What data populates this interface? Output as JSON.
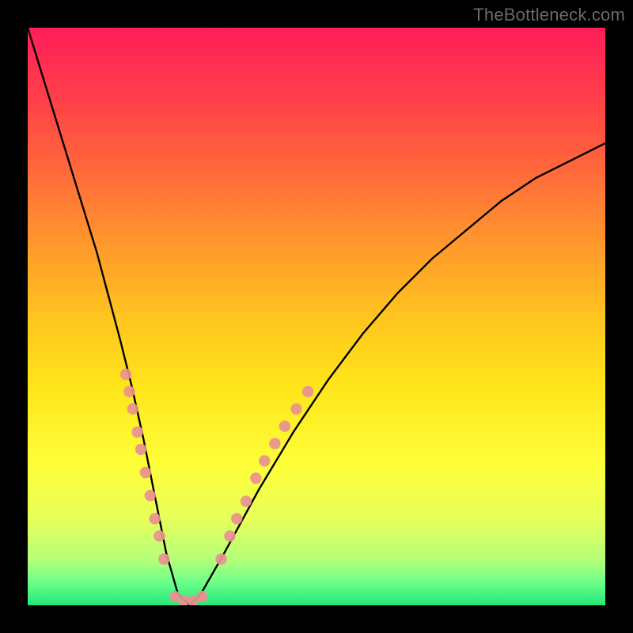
{
  "watermark": "TheBottleneck.com",
  "chart_data": {
    "type": "line",
    "title": "",
    "xlabel": "",
    "ylabel": "",
    "xlim": [
      0,
      100
    ],
    "ylim": [
      0,
      100
    ],
    "series": [
      {
        "name": "bottleneck-curve",
        "x": [
          0,
          4,
          8,
          12,
          16,
          18,
          20,
          22,
          24,
          26,
          28,
          30,
          34,
          40,
          46,
          52,
          58,
          64,
          70,
          76,
          82,
          88,
          94,
          100
        ],
        "y": [
          100,
          87,
          74,
          61,
          46,
          38,
          29,
          19,
          9,
          2,
          0,
          2,
          9,
          20,
          30,
          39,
          47,
          54,
          60,
          65,
          70,
          74,
          77,
          80
        ]
      }
    ],
    "markers": [
      {
        "name": "dots-left-branch",
        "points": [
          {
            "x": 17.0,
            "y": 40
          },
          {
            "x": 17.6,
            "y": 37
          },
          {
            "x": 18.2,
            "y": 34
          },
          {
            "x": 19.0,
            "y": 30
          },
          {
            "x": 19.6,
            "y": 27
          },
          {
            "x": 20.4,
            "y": 23
          },
          {
            "x": 21.2,
            "y": 19
          },
          {
            "x": 22.0,
            "y": 15
          },
          {
            "x": 22.8,
            "y": 12
          },
          {
            "x": 23.6,
            "y": 8
          }
        ]
      },
      {
        "name": "dots-trough",
        "points": [
          {
            "x": 25.5,
            "y": 1.5
          },
          {
            "x": 27.0,
            "y": 0.8
          },
          {
            "x": 28.6,
            "y": 0.8
          },
          {
            "x": 30.2,
            "y": 1.5
          }
        ]
      },
      {
        "name": "dots-right-branch",
        "points": [
          {
            "x": 33.5,
            "y": 8
          },
          {
            "x": 35.0,
            "y": 12
          },
          {
            "x": 36.2,
            "y": 15
          },
          {
            "x": 37.8,
            "y": 18
          },
          {
            "x": 39.5,
            "y": 22
          },
          {
            "x": 41.0,
            "y": 25
          },
          {
            "x": 42.8,
            "y": 28
          },
          {
            "x": 44.5,
            "y": 31
          },
          {
            "x": 46.5,
            "y": 34
          },
          {
            "x": 48.5,
            "y": 37
          }
        ]
      }
    ],
    "marker_color": "#e9918f",
    "curve_color": "#000000"
  }
}
